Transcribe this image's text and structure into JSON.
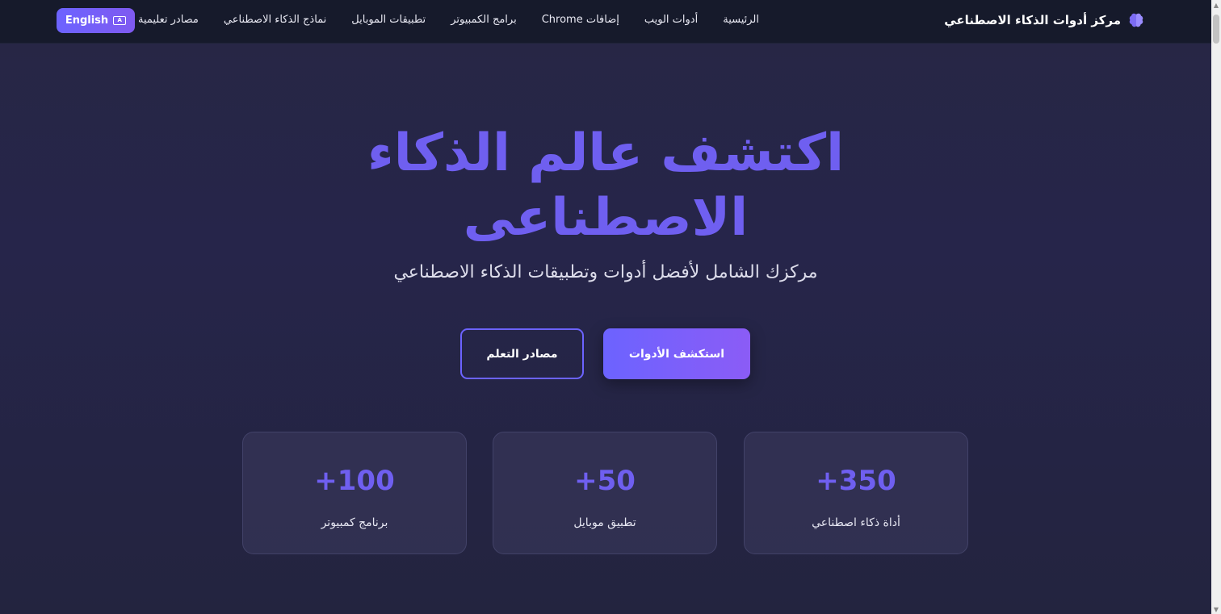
{
  "nav": {
    "brand": "مركز أدوات الذكاء الاصطناعي",
    "links": [
      "الرئيسية",
      "أدوات الويب",
      "إضافات Chrome",
      "برامج الكمبيوتر",
      "تطبيقات الموبايل",
      "نماذج الذكاء الاصطناعي",
      "مصادر تعليمية"
    ],
    "lang_button": "English"
  },
  "hero": {
    "title": "اكتشف عالم الذكاء الاصطناعى",
    "subtitle": "مركزك الشامل لأفضل أدوات وتطبيقات الذكاء الاصطناعي",
    "primary_button": "استكشف الأدوات",
    "secondary_button": "مصادر التعلم"
  },
  "stats": [
    {
      "value": "+350",
      "label": "أداة ذكاء اصطناعي"
    },
    {
      "value": "+50",
      "label": "تطبيق موبايل"
    },
    {
      "value": "+100",
      "label": "برنامج كمبيوتر"
    }
  ],
  "colors": {
    "accent": "#6c63ff",
    "accent_alt": "#8b5cf6",
    "background": "#26254a",
    "navbar": "#161a2b"
  },
  "icons": {
    "brand": "brain-icon",
    "lang": "language-icon"
  }
}
